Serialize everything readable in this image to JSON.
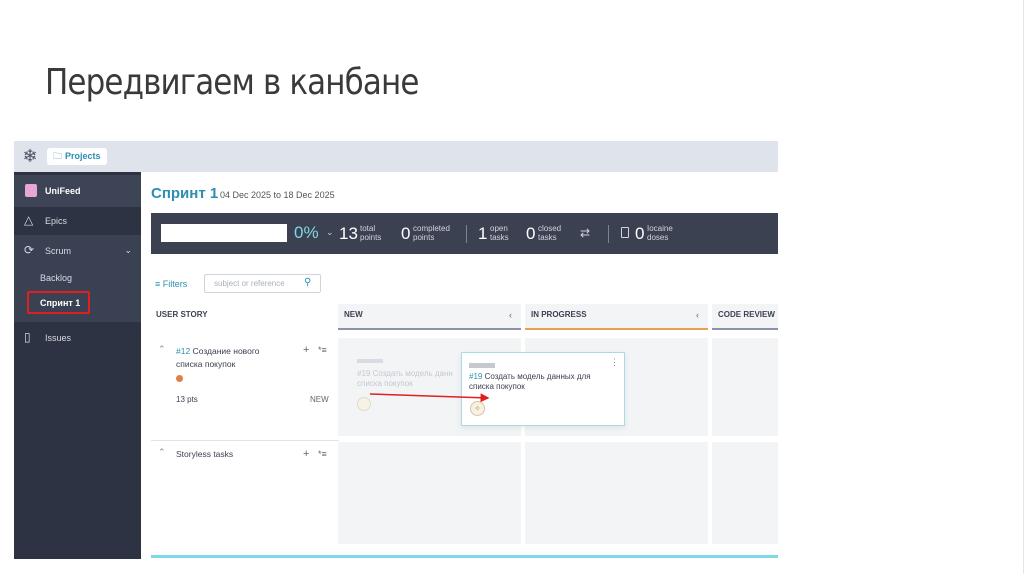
{
  "slide": {
    "title": "Передвигаем в канбане"
  },
  "topbar": {
    "projects_label": "Projects"
  },
  "sidebar": {
    "unifeed": "UniFeed",
    "epics": "Epics",
    "scrum": "Scrum",
    "backlog": "Backlog",
    "sprint": "Спринт 1",
    "issues": "Issues"
  },
  "sprint": {
    "title": "Спринт 1",
    "dates": "04 Dec 2025 to 18 Dec 2025"
  },
  "stats": {
    "percent": "0%",
    "total_points": "13",
    "total_label": "total\npoints",
    "completed_points": "0",
    "completed_label": "completed\npoints",
    "open_tasks": "1",
    "open_label": "open\ntasks",
    "closed_tasks": "0",
    "closed_label": "closed\ntasks",
    "doses": "0",
    "doses_label": "Iocaine\ndoses",
    "completion_fraction": 0
  },
  "filters": {
    "label": "Filters",
    "search_placeholder": "subject or reference"
  },
  "board": {
    "user_story_header": "USER STORY",
    "columns": [
      {
        "name": "NEW",
        "color": "#8c93a8"
      },
      {
        "name": "IN PROGRESS",
        "color": "#e8a052"
      },
      {
        "name": "CODE REVIEW",
        "color": "#8c93a8"
      }
    ],
    "stories": [
      {
        "ref": "#12",
        "title": "Создание нового списка покупок",
        "points": "13 pts",
        "status": "NEW"
      },
      {
        "title": "Storyless tasks"
      }
    ],
    "ghost_card_text": "#19 Создать модель данн\nсписка покупок",
    "card": {
      "ref": "#19",
      "title": "Создать модель данных для списка покупок"
    }
  },
  "colors": {
    "accent": "#2c8fb0",
    "drag_arrow": "#e02020",
    "progress": "#7ed8e6"
  }
}
